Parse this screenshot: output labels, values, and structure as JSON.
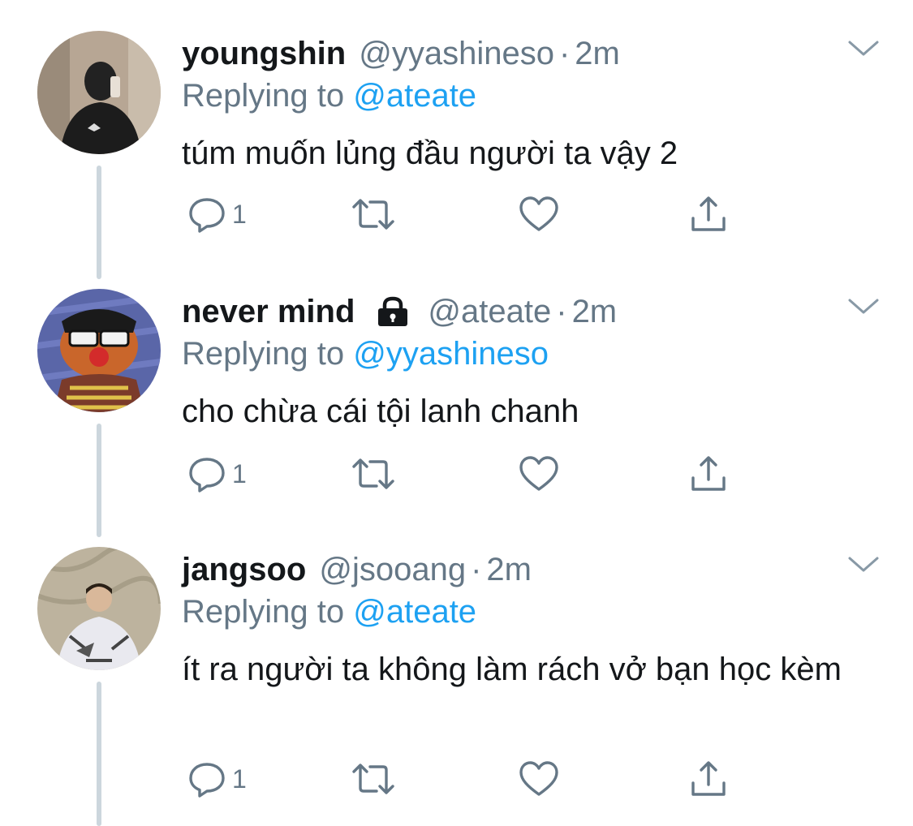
{
  "tweets": [
    {
      "name": "youngshin",
      "handle": "@yyashineso",
      "dot": "·",
      "time": "2m",
      "replying_prefix": "Replying to ",
      "replying_to": "@ateate",
      "text": "túm muốn lủng đầu người ta vậy 2",
      "reply_count": "1",
      "locked": false
    },
    {
      "name": "never mind",
      "handle": "@ateate",
      "dot": "·",
      "time": "2m",
      "replying_prefix": "Replying to ",
      "replying_to": "@yyashineso",
      "text": "cho chừa cái tội lanh chanh",
      "reply_count": "1",
      "locked": true
    },
    {
      "name": "jangsoo",
      "handle": "@jsooang",
      "dot": "·",
      "time": "2m",
      "replying_prefix": "Replying to ",
      "replying_to": "@ateate",
      "text": "ít ra người ta không làm rách vở bạn học kèm",
      "reply_count": "1",
      "locked": false
    }
  ],
  "icons": {
    "reply": "reply-icon",
    "retweet": "retweet-icon",
    "like": "heart-icon",
    "share": "share-icon",
    "more": "chevron-down-icon",
    "lock": "lock-icon"
  },
  "colors": {
    "link": "#1da1f2",
    "secondary": "#657786",
    "thread_line": "#ccd6dd",
    "text": "#14171a"
  }
}
